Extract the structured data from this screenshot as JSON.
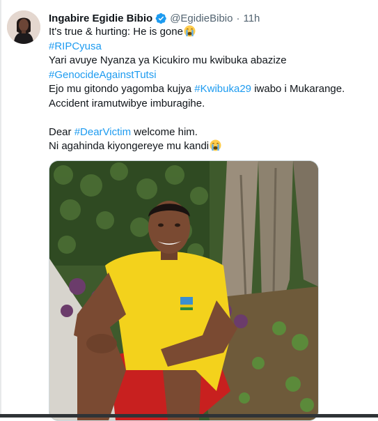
{
  "tweet": {
    "author": {
      "display_name": "Ingabire Egidie Bibio",
      "handle": "@EgidieBibio",
      "verified": true,
      "avatar_icon": "profile-photo"
    },
    "separator": "·",
    "timestamp": "11h",
    "lines": {
      "l1": "It's true & hurting: He is gone",
      "l2_hashtag": "#RIPCyusa",
      "l3": "Yari avuye Nyanza ya Kicukiro mu kwibuka abazize",
      "l4_hashtag": "#GenocideAgainstTutsi",
      "l5_prefix": "Ejo mu gitondo yagomba kujya ",
      "l5_hashtag": "#Kwibuka29",
      "l5_suffix": " iwabo i Mukarange.",
      "l6": "Accident iramutwibye imburagihe.",
      "l7_prefix": "Dear ",
      "l7_hashtag": "#DearVictim",
      "l7_suffix": " welcome him.",
      "l8": "Ni agahinda kiyongereye mu kandi"
    },
    "emoji": "crying-face",
    "media": {
      "type": "photo",
      "description_icon": "man-yellow-shirt-photo"
    }
  },
  "colors": {
    "text": "#0f1419",
    "secondary": "#536471",
    "link": "#1d9bf0",
    "verified": "#1d9bf0"
  }
}
